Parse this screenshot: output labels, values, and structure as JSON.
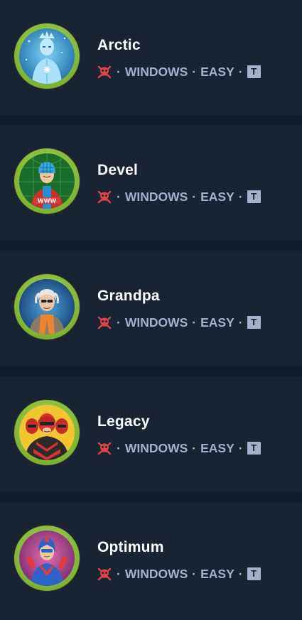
{
  "colors": {
    "background": "#141d2b",
    "card": "#1a2332",
    "ring": "#8cc043",
    "text_primary": "#ffffff",
    "text_secondary": "#a4b1cd",
    "retired_icon": "#e0434b"
  },
  "machines": [
    {
      "name": "Arctic",
      "os": "WINDOWS",
      "difficulty": "EASY",
      "tag": "T",
      "status_icon": "retired-skull-icon"
    },
    {
      "name": "Devel",
      "os": "WINDOWS",
      "difficulty": "EASY",
      "tag": "T",
      "status_icon": "retired-skull-icon"
    },
    {
      "name": "Grandpa",
      "os": "WINDOWS",
      "difficulty": "EASY",
      "tag": "T",
      "status_icon": "retired-skull-icon"
    },
    {
      "name": "Legacy",
      "os": "WINDOWS",
      "difficulty": "EASY",
      "tag": "T",
      "status_icon": "retired-skull-icon"
    },
    {
      "name": "Optimum",
      "os": "WINDOWS",
      "difficulty": "EASY",
      "tag": "T",
      "status_icon": "retired-skull-icon"
    }
  ],
  "separator": "·"
}
